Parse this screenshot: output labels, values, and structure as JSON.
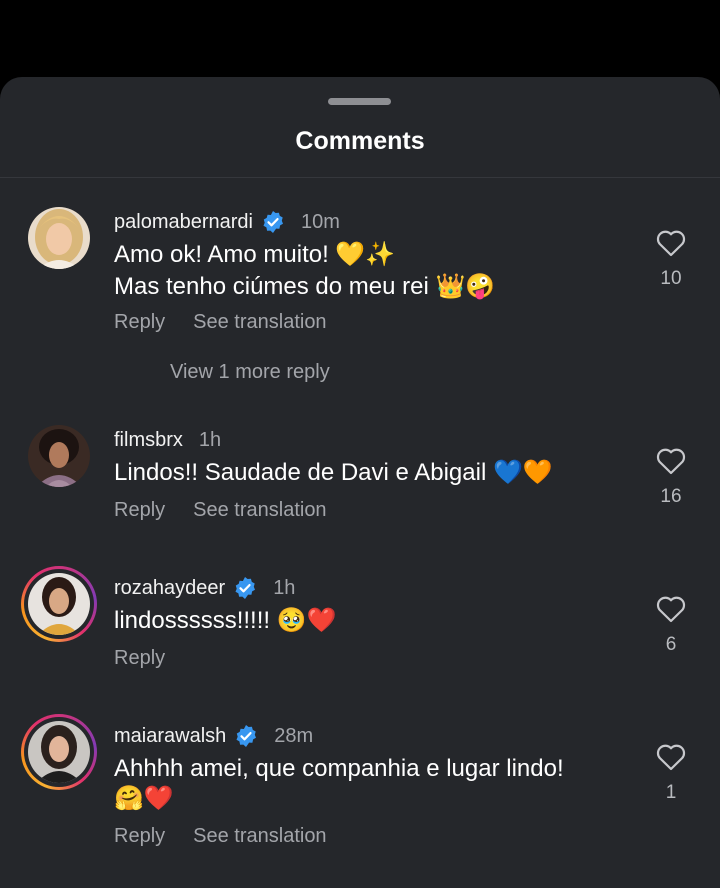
{
  "sheet": {
    "title": "Comments"
  },
  "comments": [
    {
      "username": "palomabernardi",
      "verified": true,
      "time": "10m",
      "lines": [
        "Amo ok! Amo muito! 💛✨",
        "Mas tenho ciúmes do meu rei 👑🤪"
      ],
      "reply_label": "Reply",
      "translate_label": "See translation",
      "likes": "10",
      "view_more": "View 1 more reply"
    },
    {
      "username": "filmsbrx",
      "verified": false,
      "time": "1h",
      "lines": [
        "Lindos!! Saudade de Davi e Abigail 💙🧡"
      ],
      "reply_label": "Reply",
      "translate_label": "See translation",
      "likes": "16"
    },
    {
      "username": "rozahaydeer",
      "verified": true,
      "time": "1h",
      "lines": [
        "lindossssss!!!!! 🥹❤️"
      ],
      "reply_label": "Reply",
      "likes": "6",
      "has_story": true
    },
    {
      "username": "maiarawalsh",
      "verified": true,
      "time": "28m",
      "lines": [
        "Ahhhh amei, que companhia e lugar lindo!",
        "🤗❤️"
      ],
      "reply_label": "Reply",
      "translate_label": "See translation",
      "likes": "1",
      "has_story": true
    }
  ],
  "icons": {
    "verified": "verified-badge-icon",
    "like": "heart-outline-icon"
  },
  "colors": {
    "background": "#000000",
    "sheet": "#25272b",
    "verified_blue": "#3897f0",
    "secondary_text": "#a3a5aa"
  }
}
